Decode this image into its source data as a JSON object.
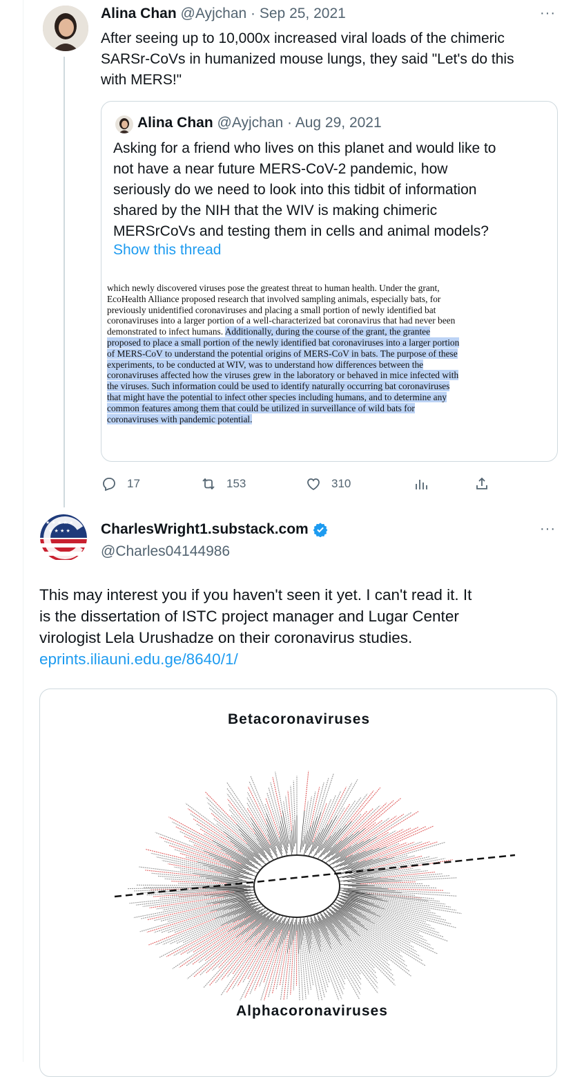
{
  "tweet1": {
    "name": "Alina Chan",
    "handle": "@Ayjchan",
    "separator": "·",
    "date": "Sep 25, 2021",
    "more": "···",
    "text_lines": [
      "After seeing up to 10,000x increased viral loads of the chimeric",
      "SARSr-CoVs in humanized mouse lungs, they said \"Let's do this",
      "with MERS!\""
    ]
  },
  "quoted": {
    "name": "Alina Chan",
    "handle": "@Ayjchan",
    "separator": "·",
    "date": "Aug 29, 2021",
    "text_lines": [
      "Asking for a friend who lives on this planet and would like to",
      "not have a near future MERS-CoV-2 pandemic, how",
      "seriously do we need to look into this tidbit of information",
      "shared by the NIH that the WIV is making chimeric",
      "MERSrCoVs and testing them in cells and animal models?"
    ],
    "show_thread": "Show this thread",
    "doc_lines": [
      {
        "t": "which newly discovered viruses pose the greatest threat to human health.  Under the grant,",
        "h": false
      },
      {
        "t": "EcoHealth Alliance proposed research that involved sampling animals, especially bats, for",
        "h": false
      },
      {
        "t": "previously unidentified coronaviruses and placing a small portion of newly identified bat",
        "h": false
      },
      {
        "t": "coronaviruses into a larger portion of a well-characterized bat coronavirus that had never been",
        "h": false
      },
      {
        "t": "demonstrated to infect humans.  ",
        "h": false,
        "t2": "Additionally, during the course of the grant, the grantee"
      },
      {
        "t": "proposed to place a small portion of the newly identified bat coronaviruses into a larger portion",
        "h": true
      },
      {
        "t": "of MERS-CoV to understand the potential origins of MERS-CoV in bats.  The purpose of these",
        "h": true
      },
      {
        "t": "experiments, to be conducted at WIV, was to understand how differences between the",
        "h": true
      },
      {
        "t": "coronaviruses affected how the viruses grew in the laboratory or behaved in mice infected with",
        "h": true
      },
      {
        "t": "the viruses.  Such information could be used to identify naturally occurring bat coronaviruses",
        "h": true
      },
      {
        "t": "that might have the potential to infect other species including humans, and to determine any",
        "h": true
      },
      {
        "t": "common features among them that could be utilized in surveillance of wild bats for",
        "h": true
      },
      {
        "t": "coronaviruses with pandemic potential.",
        "h": true
      }
    ]
  },
  "actions": {
    "reply": "17",
    "retweet": "153",
    "like": "310"
  },
  "tweet2": {
    "name": "CharlesWright1.substack.com",
    "handle": "@Charles04144986",
    "more": "···",
    "text_lines": [
      "This may interest you if you haven't seen it yet.  I can't read it.  It",
      "is the dissertation of ISTC project manager and Lugar Center",
      "virologist Lela Urushadze on their coronavirus studies."
    ],
    "link": "eprints.iliauni.edu.ge/8640/1/"
  },
  "media": {
    "top_label": "Betacoronaviruses",
    "bottom_label": "Alphacoronaviruses"
  },
  "colors": {
    "link": "#1d9bf0",
    "verified": "#1d9bf0",
    "highlight": "#bcd3f5",
    "tree_red": "#e06060"
  }
}
